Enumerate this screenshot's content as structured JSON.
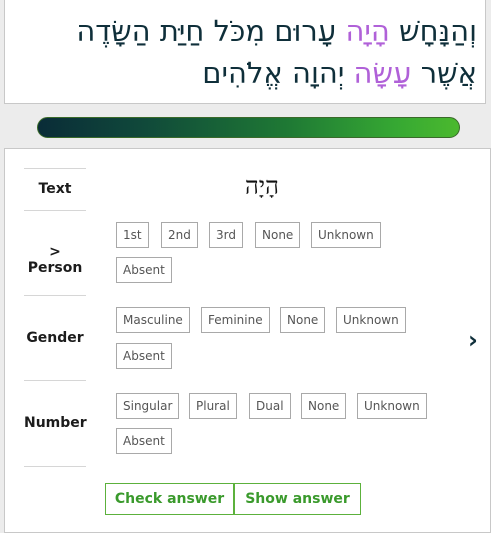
{
  "verse": {
    "words": [
      {
        "text": "וְהַנָּחָשׁ",
        "highlight": false
      },
      {
        "text": "הָיָה",
        "highlight": true
      },
      {
        "text": "עָרוּם",
        "highlight": false
      },
      {
        "text": "מִכֹּל",
        "highlight": false
      },
      {
        "text": "חַיַּת",
        "highlight": false
      },
      {
        "text": "הַשָּׂדֶה",
        "highlight": false
      },
      {
        "text": "אֲשֶׁר",
        "highlight": false
      },
      {
        "text": "עָשָׂה",
        "highlight": true
      },
      {
        "text": "יְהוָה",
        "highlight": false
      },
      {
        "text": "אֱלֹהִים",
        "highlight": false
      }
    ],
    "highlight_color": "#b061d8",
    "text_color": "#0f2f3a"
  },
  "progress": {
    "fraction": 1.0,
    "colors": [
      "#0a2c38",
      "#4bb92e"
    ]
  },
  "quiz": {
    "text_label": "Text",
    "word": "הָיָה",
    "person": {
      "label": "> Person",
      "options": [
        "1st",
        "2nd",
        "3rd",
        "None",
        "Unknown",
        "Absent"
      ]
    },
    "gender": {
      "label": "Gender",
      "options": [
        "Masculine",
        "Feminine",
        "None",
        "Unknown",
        "Absent"
      ]
    },
    "number": {
      "label": "Number",
      "options": [
        "Singular",
        "Plural",
        "Dual",
        "None",
        "Unknown",
        "Absent"
      ]
    },
    "check_label": "Check answer",
    "show_label": "Show answer",
    "next_icon": "›"
  }
}
